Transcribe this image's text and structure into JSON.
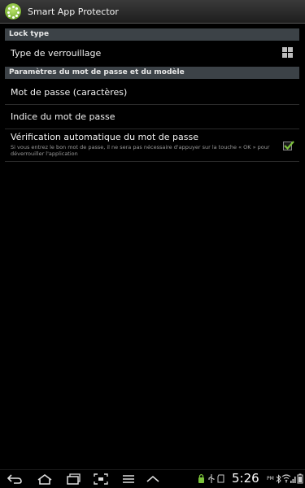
{
  "app": {
    "title": "Smart App Protector",
    "accent_color": "#7cc23a"
  },
  "sections": {
    "lock_type": {
      "header": "Lock type",
      "items": [
        {
          "label": "Type de verrouillage",
          "icon": "grid-pattern-icon"
        }
      ]
    },
    "password_params": {
      "header": "Paramètres du mot de passe et du modèle",
      "items": [
        {
          "label": "Mot de passe (caractères)"
        },
        {
          "label": "Indice du mot de passe"
        },
        {
          "label": "Vérification automatique du mot de passe",
          "summary": "Si vous entrez le bon mot de passe, il ne sera pas nécessaire d'appuyer sur la touche « OK » pour déverrouiller l'application",
          "checked": true
        }
      ]
    }
  },
  "navbar": {
    "buttons": [
      "back-icon",
      "home-icon",
      "recent-apps-icon",
      "screenshot-icon",
      "menu-icon",
      "up-arrow-icon"
    ],
    "status_icons": [
      "lock-icon",
      "usb-icon",
      "sd-card-icon",
      "bluetooth-icon",
      "wifi-icon",
      "signal-icon",
      "battery-icon"
    ],
    "time": "5:26",
    "ampm": "PM"
  }
}
